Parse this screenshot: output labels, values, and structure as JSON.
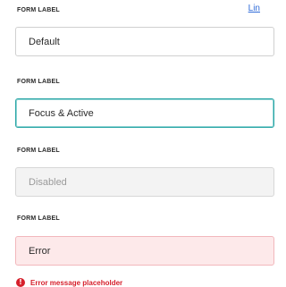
{
  "form": {
    "link_text": "Lin",
    "fields": [
      {
        "label": "FORM LABEL",
        "value": "Default",
        "state": "default"
      },
      {
        "label": "FORM LABEL",
        "value": "Focus & Active",
        "state": "focus"
      },
      {
        "label": "FORM LABEL",
        "value": "Disabled",
        "state": "disabled"
      },
      {
        "label": "FORM LABEL",
        "value": "Error",
        "state": "error"
      }
    ],
    "error_message": "Error message placeholder",
    "error_icon_glyph": "!"
  },
  "colors": {
    "focus_border": "#2aa6a6",
    "error_bg": "#fde9ea",
    "error_text": "#d61f2b",
    "link": "#2f6bd8"
  }
}
